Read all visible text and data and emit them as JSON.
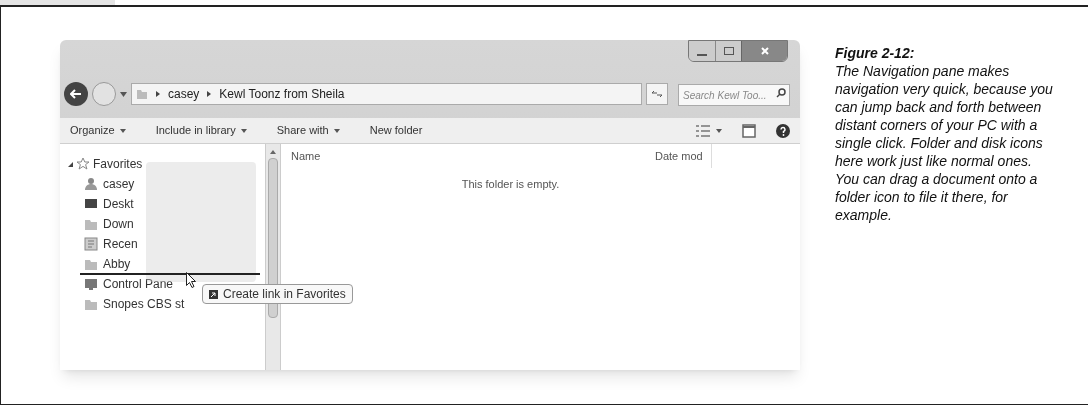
{
  "window": {
    "address": [
      "casey",
      "Kewl Toonz from Sheila"
    ],
    "search": {
      "placeholder": "Search Kewl Too..."
    },
    "toolbar": [
      {
        "label": "Organize",
        "dropdown": true
      },
      {
        "label": "Include in library",
        "dropdown": true
      },
      {
        "label": "Share with",
        "dropdown": true
      },
      {
        "label": "New folder",
        "dropdown": false
      }
    ],
    "navigation": [
      {
        "label": "Favorites",
        "kind": "group",
        "expanded": true,
        "children": [
          {
            "label": "casey",
            "kind": "user"
          },
          {
            "label": "Deskt",
            "kind": "desktop"
          },
          {
            "label": "Down",
            "kind": "folder"
          },
          {
            "label": "Recen",
            "kind": "recent"
          },
          {
            "label": "Abby",
            "kind": "folder"
          },
          {
            "label": "Control Pane",
            "kind": "control"
          },
          {
            "label": "Snopes CBS st",
            "kind": "folder"
          }
        ]
      }
    ],
    "columns": [
      "Name",
      "Date mod"
    ],
    "empty_message": "This folder is empty.",
    "drag_tooltip": "Create link in Favorites"
  },
  "figure": {
    "label": "Figure 2-12:",
    "caption": "The Navigation pane makes navigation very quick, because you can jump back and forth between distant corners of your PC with a single click. Folder and disk icons here work just like normal ones. You can drag a document onto a folder icon to file it there, for example."
  }
}
